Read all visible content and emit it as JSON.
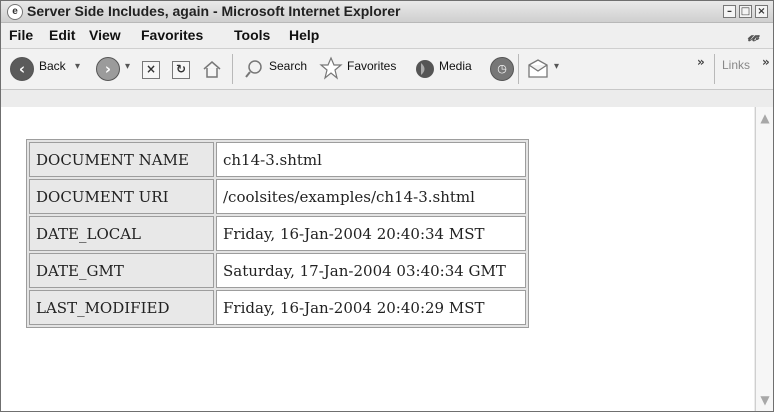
{
  "window": {
    "title": "Server Side Includes, again - Microsoft Internet Explorer",
    "controls": [
      "–",
      "□",
      "×"
    ]
  },
  "menu": [
    "File",
    "Edit",
    "View",
    "Favorites",
    "Tools",
    "Help"
  ],
  "toolbar": {
    "back": "Back",
    "search": "Search",
    "favorites": "Favorites",
    "media": "Media",
    "more": "»",
    "links": "Links"
  },
  "table": [
    [
      "DOCUMENT NAME",
      "ch14-3.shtml"
    ],
    [
      "DOCUMENT URI",
      "/coolsites/examples/ch14-3.shtml"
    ],
    [
      "DATE_LOCAL",
      "Friday, 16-Jan-2004 20:40:34 MST"
    ],
    [
      "DATE_GMT",
      "Saturday, 17-Jan-2004 03:40:34 GMT"
    ],
    [
      "LAST_MODIFIED",
      "Friday, 16-Jan-2004 20:40:29 MST"
    ]
  ],
  "colors": {
    "chrome": "#ececec",
    "content_bg": "#ffffff",
    "table_border": "#9d9d9d"
  },
  "icons": {
    "back": "back-arrow-icon",
    "forward": "forward-arrow-icon",
    "stop": "stop-icon",
    "refresh": "refresh-icon",
    "home": "home-icon",
    "search": "search-icon",
    "favorites": "star-icon",
    "media": "media-icon",
    "history": "history-icon",
    "mail": "mail-icon"
  }
}
